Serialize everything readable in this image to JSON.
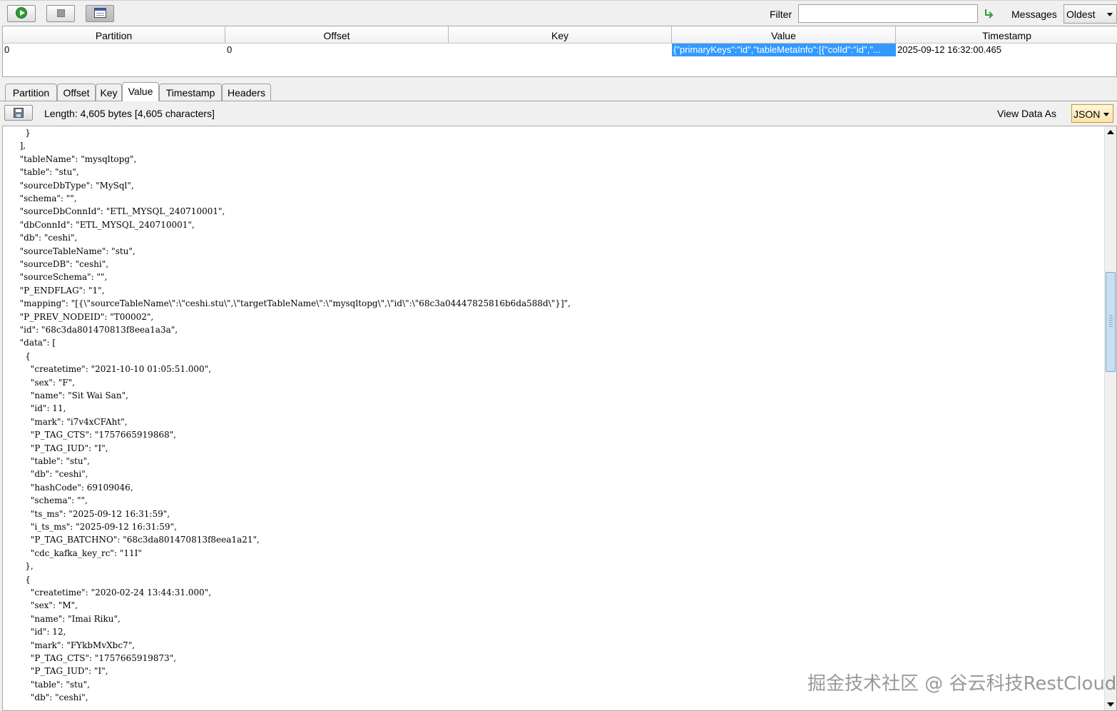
{
  "toolbar": {
    "filter_label": "Filter",
    "filter_value": "",
    "messages_label": "Messages",
    "messages_value": "Oldest"
  },
  "table": {
    "columns": [
      "Partition",
      "Offset",
      "Key",
      "Value",
      "Timestamp"
    ],
    "rows": [
      {
        "partition": "0",
        "offset": "0",
        "key": "",
        "value": "{\"primaryKeys\":\"id\",\"tableMetaInfo\":[{\"colId\":\"id\",\"...",
        "timestamp": "2025-09-12 16:32:00.465"
      }
    ]
  },
  "tabs": [
    "Partition",
    "Offset",
    "Key",
    "Value",
    "Timestamp",
    "Headers"
  ],
  "active_tab": "Value",
  "infobar": {
    "length_text": "Length: 4,605 bytes [4,605 characters]",
    "view_as_label": "View Data As",
    "view_as_value": "JSON"
  },
  "editor": {
    "lines": [
      "    }",
      "  ],",
      "  \"tableName\": \"mysqltopg\",",
      "  \"table\": \"stu\",",
      "  \"sourceDbType\": \"MySql\",",
      "  \"schema\": \"\",",
      "  \"sourceDbConnId\": \"ETL_MYSQL_240710001\",",
      "  \"dbConnId\": \"ETL_MYSQL_240710001\",",
      "  \"db\": \"ceshi\",",
      "  \"sourceTableName\": \"stu\",",
      "  \"sourceDB\": \"ceshi\",",
      "  \"sourceSchema\": \"\",",
      "  \"P_ENDFLAG\": \"1\",",
      "  \"mapping\": \"[{\\\"sourceTableName\\\":\\\"ceshi.stu\\\",\\\"targetTableName\\\":\\\"mysqltopg\\\",\\\"id\\\":\\\"68c3a04447825816b6da588d\\\"}]\",",
      "  \"P_PREV_NODEID\": \"T00002\",",
      "  \"id\": \"68c3da801470813f8eea1a3a\",",
      "  \"data\": [",
      "    {",
      "      \"createtime\": \"2021-10-10 01:05:51.000\",",
      "      \"sex\": \"F\",",
      "      \"name\": \"Sit Wai San\",",
      "      \"id\": 11,",
      "      \"mark\": \"i7v4xCFAht\",",
      "      \"P_TAG_CTS\": \"1757665919868\",",
      "      \"P_TAG_IUD\": \"I\",",
      "      \"table\": \"stu\",",
      "      \"db\": \"ceshi\",",
      "      \"hashCode\": 69109046,",
      "      \"schema\": \"\",",
      "      \"ts_ms\": \"2025-09-12 16:31:59\",",
      "      \"i_ts_ms\": \"2025-09-12 16:31:59\",",
      "      \"P_TAG_BATCHNO\": \"68c3da801470813f8eea1a21\",",
      "      \"cdc_kafka_key_rc\": \"11I\"",
      "    },",
      "    {",
      "      \"createtime\": \"2020-02-24 13:44:31.000\",",
      "      \"sex\": \"M\",",
      "      \"name\": \"Imai Riku\",",
      "      \"id\": 12,",
      "      \"mark\": \"FYkbMvXbc7\",",
      "      \"P_TAG_CTS\": \"1757665919873\",",
      "      \"P_TAG_IUD\": \"I\",",
      "      \"table\": \"stu\",",
      "      \"db\": \"ceshi\","
    ]
  },
  "watermark": "掘金技术社区 @ 谷云科技RestCloud"
}
